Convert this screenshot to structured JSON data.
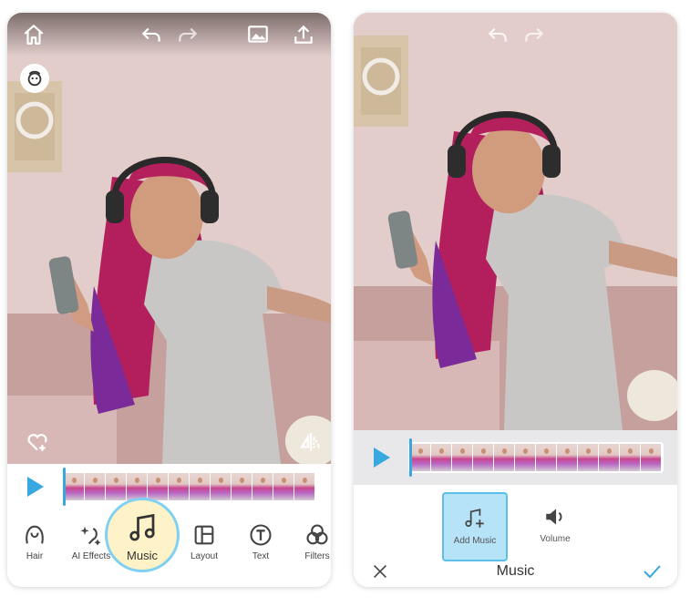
{
  "screen1": {
    "toolbar": {
      "tools": [
        {
          "label": "Hair",
          "icon": "hair-icon"
        },
        {
          "label": "AI Effects",
          "icon": "ai-effects-icon"
        },
        {
          "label": "Music",
          "icon": "music-note-icon",
          "selected": true
        },
        {
          "label": "Layout",
          "icon": "layout-icon"
        },
        {
          "label": "Text",
          "icon": "text-icon"
        },
        {
          "label": "Filters",
          "icon": "filters-icon"
        }
      ]
    },
    "top_icons": [
      "home-icon",
      "undo-icon",
      "redo-icon",
      "gallery-icon",
      "share-icon"
    ],
    "overlay_icons": [
      "face-retouch-icon",
      "heart-add-icon",
      "compare-split-icon"
    ],
    "timeline_frames": 12
  },
  "screen2": {
    "panel": {
      "title": "Music",
      "options": [
        {
          "label": "Add Music",
          "icon": "add-music-icon",
          "selected": true
        },
        {
          "label": "Volume",
          "icon": "volume-icon"
        }
      ],
      "cancel_icon": "close-icon",
      "confirm_icon": "checkmark-icon"
    },
    "top_icons": [
      "undo-icon",
      "redo-icon"
    ],
    "timeline_frames": 12
  },
  "colors": {
    "accent_blue": "#38a8e0",
    "music_highlight": "#fdf2c8",
    "selected_option": "#b6e3f8"
  }
}
